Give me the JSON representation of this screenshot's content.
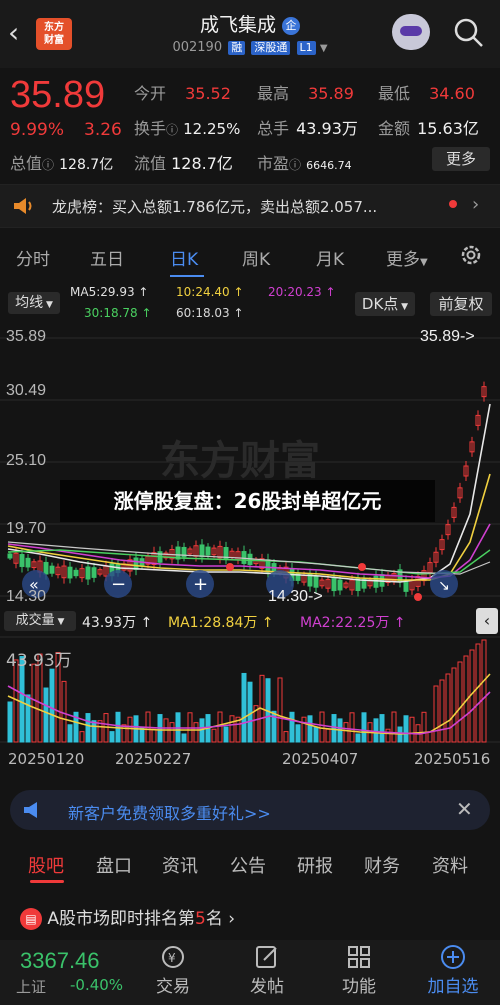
{
  "header": {
    "back_icon": "chevron-left-icon",
    "logo_line1": "东方",
    "logo_line2": "财富",
    "title": "成飞集成",
    "title_badge": "企",
    "code": "002190",
    "tag_rong": "融",
    "tag_sgt": "深股通",
    "tag_l1": "L1"
  },
  "quote": {
    "price": "35.89",
    "pct": "9.99%",
    "change": "3.26",
    "open_label": "今开",
    "open": "35.52",
    "high_label": "最高",
    "high": "35.89",
    "low_label": "最低",
    "low": "34.60",
    "turnover_label": "换手",
    "turnover": "12.25%",
    "volume_label": "总手",
    "volume": "43.93万",
    "amount_label": "金额",
    "amount": "15.63亿",
    "total_cap_label": "总值",
    "total_cap": "128.7亿",
    "float_cap_label": "流值",
    "float_cap": "128.7亿",
    "pe_label": "市盈",
    "pe": "6646.74",
    "more_label": "更多"
  },
  "lhb": {
    "text": "龙虎榜：买入总额1.786亿元，卖出总额2.057..."
  },
  "tabs": [
    "分时",
    "五日",
    "日K",
    "周K",
    "月K",
    "更多"
  ],
  "ma": {
    "type_label": "均线",
    "ma5": "MA5:29.93 ↑",
    "ma10": "10:24.40 ↑",
    "ma20": "20:20.23 ↑",
    "ma30": "30:18.78 ↑",
    "ma60": "60:18.03 ↑",
    "dk_label": "DK点",
    "fq_label": "前复权"
  },
  "chart": {
    "y_labels": [
      "35.89",
      "30.49",
      "25.10",
      "19.70",
      "14.30"
    ],
    "price_marker": "35.89->",
    "low_marker": "14.30->",
    "headline": "涨停股复盘：26股封单超亿元"
  },
  "volume": {
    "label": "成交量",
    "vol": "43.93万 ↑",
    "ma1": "MA1:28.84万 ↑",
    "ma2": "MA2:22.25万 ↑",
    "max_label": "43.93万",
    "dates": [
      "20250120",
      "20250227",
      "20250407",
      "20250516"
    ]
  },
  "promo": {
    "text": "新客户免费领取多重好礼>>"
  },
  "section_tabs": [
    "股吧",
    "盘口",
    "资讯",
    "公告",
    "研报",
    "财务",
    "资料"
  ],
  "rank": {
    "text_a": "A股市场即时排名第",
    "num": "5",
    "text_b": "名 ›"
  },
  "bottom": {
    "index_value": "3367.46",
    "index_name": "上证",
    "index_pct": "-0.40%",
    "nav": [
      "交易",
      "发帖",
      "功能",
      "加自选"
    ]
  },
  "colors": {
    "up": "#f03a3a",
    "down": "#3ac26a",
    "accent": "#4b8cf0"
  }
}
